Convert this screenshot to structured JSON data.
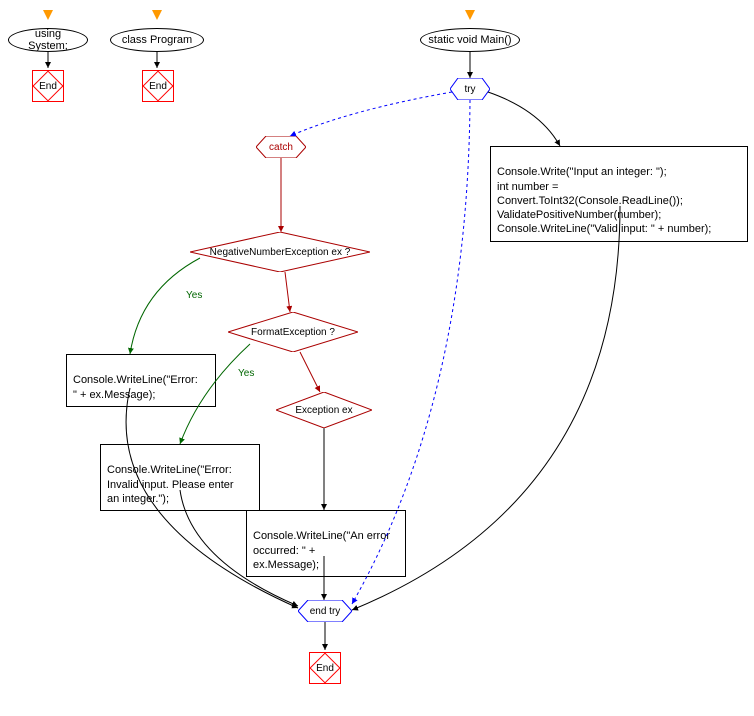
{
  "nodes": {
    "usingSystem": "using System;",
    "classProgram": "class Program",
    "staticMain": "static void Main()",
    "try": "try",
    "tryBody": "Console.Write(\"Input an integer: \");\nint number = Convert.ToInt32(Console.ReadLine());\nValidatePositiveNumber(number);\nConsole.WriteLine(\"Valid input: \" + number);",
    "catch": "catch",
    "negEx": "NegativeNumberException ex ?",
    "formatEx": "FormatException ?",
    "exceptionEx": "Exception ex",
    "negBody": "Console.WriteLine(\"Error:\n\" + ex.Message);",
    "formatBody": "Console.WriteLine(\"Error:\nInvalid input. Please enter\nan integer.\");",
    "exBody": "Console.WriteLine(\"An error\noccurred: \" +\nex.Message);",
    "endTry": "end try",
    "end": "End",
    "yes": "Yes"
  }
}
